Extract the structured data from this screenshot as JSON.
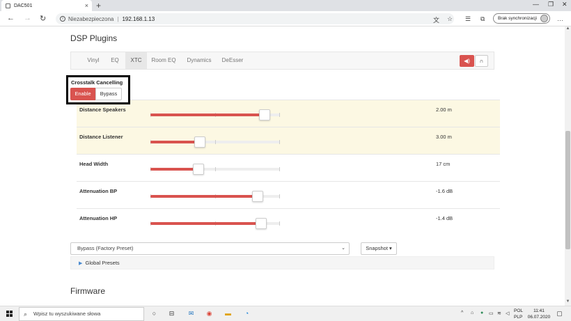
{
  "browser": {
    "tab_title": "DAC501",
    "new_tab": "+",
    "security_label": "Niezabezpieczona",
    "url": "192.168.1.13",
    "sync_label": "Brak synchronizacji"
  },
  "page": {
    "section_title": "DSP Plugins",
    "tabs": [
      "Vinyl",
      "EQ",
      "XTC",
      "Room EQ",
      "Dynamics",
      "DeEsser"
    ],
    "active_tab": "XTC",
    "xtc": {
      "title": "Crosstalk Cancelling",
      "enable_label": "Enable",
      "bypass_label": "Bypass"
    },
    "params": [
      {
        "label": "Distance Speakers",
        "value": "2.00 m",
        "level": 0.92,
        "highlighted": true
      },
      {
        "label": "Distance Listener",
        "value": "3.00 m",
        "level": 0.37,
        "highlighted": true
      },
      {
        "label": "Head Width",
        "value": "17 cm",
        "level": 0.36,
        "highlighted": false
      },
      {
        "label": "Attenuation BP",
        "value": "-1.6 dB",
        "level": 0.86,
        "highlighted": false
      },
      {
        "label": "Attenuation HP",
        "value": "-1.4 dB",
        "level": 0.89,
        "highlighted": false
      }
    ],
    "preset_select": "Bypass (Factory Preset)",
    "snapshot_label": "Snapshot",
    "global_presets_label": "Global Presets",
    "firmware_title": "Firmware"
  },
  "taskbar": {
    "search_placeholder": "Wpisz tu wyszukiwane słowa",
    "lang_line1": "POL",
    "lang_line2": "PLP",
    "time": "11:41",
    "date": "06.07.2020"
  },
  "colors": {
    "accent": "#d9534f",
    "highlight_row": "#fcf8e3"
  }
}
